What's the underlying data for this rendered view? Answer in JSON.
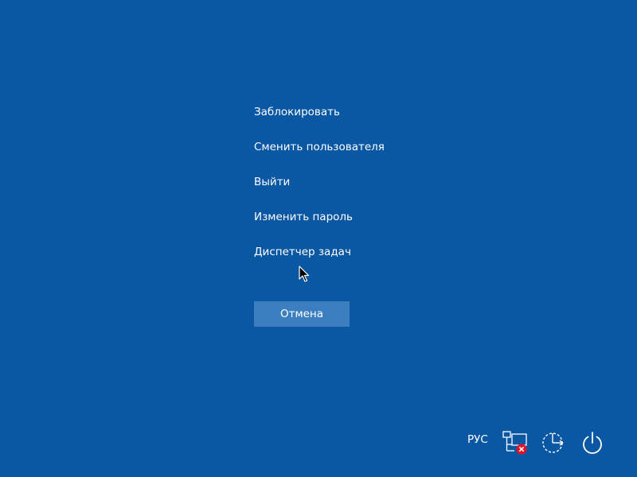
{
  "menu": {
    "items": [
      {
        "label": "Заблокировать"
      },
      {
        "label": "Сменить пользователя"
      },
      {
        "label": "Выйти"
      },
      {
        "label": "Изменить пароль"
      },
      {
        "label": "Диспетчер задач"
      }
    ]
  },
  "cancel_button": {
    "label": "Отмена"
  },
  "tray": {
    "language": "РУС",
    "icons": [
      "network-disconnected-icon",
      "ease-of-access-icon",
      "power-icon"
    ]
  },
  "colors": {
    "background": "#0a57a4",
    "button": "#3c7fc0",
    "text": "#ffffff",
    "error_badge": "#e81123"
  }
}
